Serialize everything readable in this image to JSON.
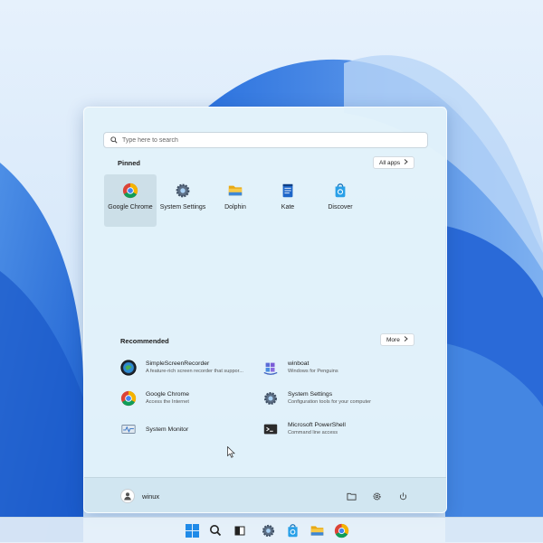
{
  "search": {
    "placeholder": "Type here to search"
  },
  "pinned": {
    "title": "Pinned",
    "all_apps_label": "All apps",
    "apps": [
      {
        "label": "Google Chrome",
        "icon": "chrome-icon"
      },
      {
        "label": "System Settings",
        "icon": "gear-icon"
      },
      {
        "label": "Dolphin",
        "icon": "folder-icon"
      },
      {
        "label": "Kate",
        "icon": "kate-icon"
      },
      {
        "label": "Discover",
        "icon": "discover-icon"
      }
    ]
  },
  "recommended": {
    "title": "Recommended",
    "more_label": "More",
    "items": [
      {
        "name": "SimpleScreenRecorder",
        "desc": "A feature-rich screen recorder that suppor...",
        "icon": "screen-recorder-icon"
      },
      {
        "name": "winboat",
        "desc": "Windows for Penguins",
        "icon": "winboat-icon"
      },
      {
        "name": "Google Chrome",
        "desc": "Access the Internet",
        "icon": "chrome-icon"
      },
      {
        "name": "System Settings",
        "desc": "Configuration tools for your computer",
        "icon": "gear-icon"
      },
      {
        "name": "System Monitor",
        "desc": "",
        "icon": "system-monitor-icon"
      },
      {
        "name": "Microsoft PowerShell",
        "desc": "Command line access",
        "icon": "terminal-icon"
      }
    ]
  },
  "footer": {
    "user_name": "winux"
  },
  "taskbar": {
    "icons": [
      "windows-start-icon",
      "search-icon",
      "task-view-icon",
      "gear-icon",
      "discover-icon",
      "folder-icon",
      "chrome-icon"
    ]
  },
  "colors": {
    "accent": "#1f6fd6",
    "menu_bg": "#e2f2fa",
    "wallpaper": "#d7e9fb"
  }
}
